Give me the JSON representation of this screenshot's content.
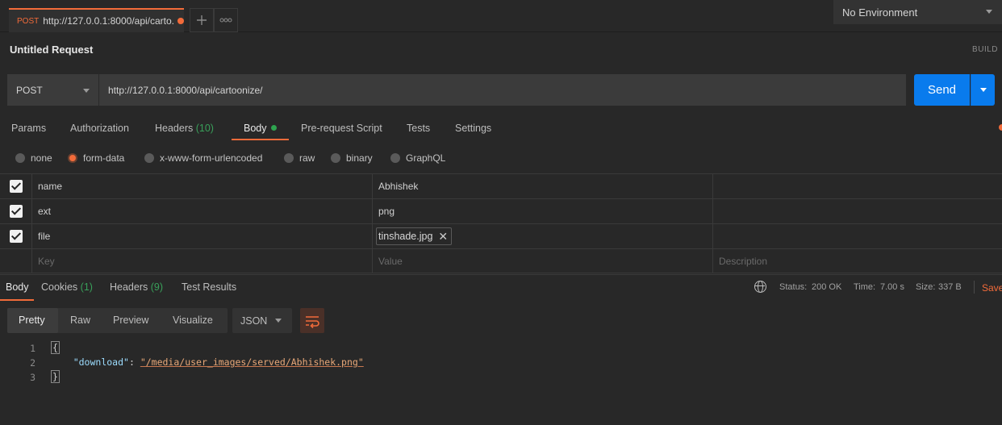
{
  "tabbar": {
    "tab_method": "POST",
    "tab_url": "http://127.0.0.1:8000/api/carto...",
    "new_tab_icon": "plus-icon",
    "more_icon": "ellipsis-icon",
    "environment": "No Environment"
  },
  "request": {
    "title": "Untitled Request",
    "build_label": "BUILD",
    "method": "POST",
    "url": "http://127.0.0.1:8000/api/cartoonize/",
    "send_label": "Send"
  },
  "request_tabs": {
    "params": "Params",
    "authorization": "Authorization",
    "headers": "Headers",
    "headers_count": "(10)",
    "body": "Body",
    "prerequest": "Pre-request Script",
    "tests": "Tests",
    "settings": "Settings"
  },
  "body_modes": {
    "none": "none",
    "form_data": "form-data",
    "urlencoded": "x-www-form-urlencoded",
    "raw": "raw",
    "binary": "binary",
    "graphql": "GraphQL",
    "selected": "form-data"
  },
  "form_rows": [
    {
      "key": "name",
      "value": "Abhishek",
      "checked": true
    },
    {
      "key": "ext",
      "value": "png",
      "checked": true
    },
    {
      "key": "file",
      "value": "tinshade.jpg",
      "checked": true
    }
  ],
  "form_placeholders": {
    "key": "Key",
    "value": "Value",
    "description": "Description"
  },
  "response_tabs": {
    "body": "Body",
    "cookies": "Cookies",
    "cookies_count": "(1)",
    "headers": "Headers",
    "headers_count": "(9)",
    "test_results": "Test Results"
  },
  "response_status": {
    "status_label": "Status:",
    "status_value": "200 OK",
    "time_label": "Time:",
    "time_value": "7.00 s",
    "size_label": "Size:",
    "size_value": "337 B",
    "save_label": "Save"
  },
  "format_bar": {
    "pretty": "Pretty",
    "raw": "Raw",
    "preview": "Preview",
    "visualize": "Visualize",
    "language": "JSON"
  },
  "response_body": {
    "line_numbers": [
      "1",
      "2",
      "3"
    ],
    "open_brace": "{",
    "key": "\"download\"",
    "colon": ": ",
    "value": "\"/media/user_images/served/Abhishek.png\"",
    "close_brace": "}"
  },
  "colors": {
    "accent": "#f26b3a",
    "send": "#097bed",
    "success": "#39a05a"
  }
}
